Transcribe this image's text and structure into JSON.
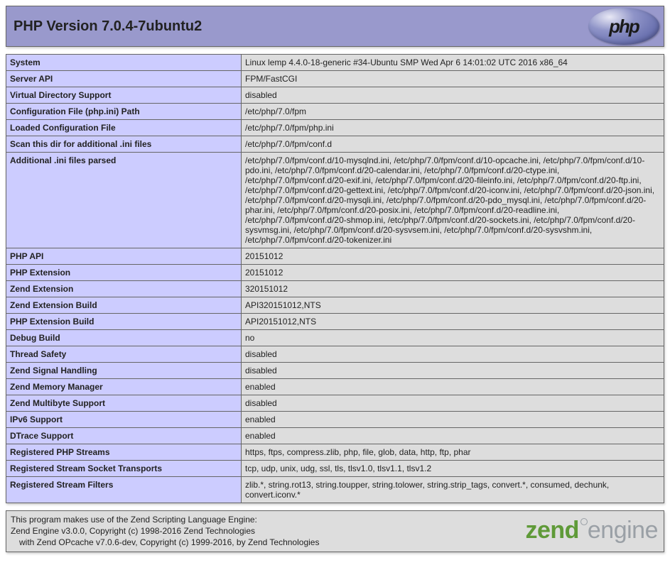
{
  "header": {
    "title": "PHP Version 7.0.4-7ubuntu2",
    "php_logo_text": "php"
  },
  "rows": [
    {
      "label": "System",
      "value": "Linux lemp 4.4.0-18-generic #34-Ubuntu SMP Wed Apr 6 14:01:02 UTC 2016 x86_64"
    },
    {
      "label": "Server API",
      "value": "FPM/FastCGI"
    },
    {
      "label": "Virtual Directory Support",
      "value": "disabled"
    },
    {
      "label": "Configuration File (php.ini) Path",
      "value": "/etc/php/7.0/fpm"
    },
    {
      "label": "Loaded Configuration File",
      "value": "/etc/php/7.0/fpm/php.ini"
    },
    {
      "label": "Scan this dir for additional .ini files",
      "value": "/etc/php/7.0/fpm/conf.d"
    },
    {
      "label": "Additional .ini files parsed",
      "value": "/etc/php/7.0/fpm/conf.d/10-mysqlnd.ini, /etc/php/7.0/fpm/conf.d/10-opcache.ini, /etc/php/7.0/fpm/conf.d/10-pdo.ini, /etc/php/7.0/fpm/conf.d/20-calendar.ini, /etc/php/7.0/fpm/conf.d/20-ctype.ini, /etc/php/7.0/fpm/conf.d/20-exif.ini, /etc/php/7.0/fpm/conf.d/20-fileinfo.ini, /etc/php/7.0/fpm/conf.d/20-ftp.ini, /etc/php/7.0/fpm/conf.d/20-gettext.ini, /etc/php/7.0/fpm/conf.d/20-iconv.ini, /etc/php/7.0/fpm/conf.d/20-json.ini, /etc/php/7.0/fpm/conf.d/20-mysqli.ini, /etc/php/7.0/fpm/conf.d/20-pdo_mysql.ini, /etc/php/7.0/fpm/conf.d/20-phar.ini, /etc/php/7.0/fpm/conf.d/20-posix.ini, /etc/php/7.0/fpm/conf.d/20-readline.ini, /etc/php/7.0/fpm/conf.d/20-shmop.ini, /etc/php/7.0/fpm/conf.d/20-sockets.ini, /etc/php/7.0/fpm/conf.d/20-sysvmsg.ini, /etc/php/7.0/fpm/conf.d/20-sysvsem.ini, /etc/php/7.0/fpm/conf.d/20-sysvshm.ini, /etc/php/7.0/fpm/conf.d/20-tokenizer.ini"
    },
    {
      "label": "PHP API",
      "value": "20151012"
    },
    {
      "label": "PHP Extension",
      "value": "20151012"
    },
    {
      "label": "Zend Extension",
      "value": "320151012"
    },
    {
      "label": "Zend Extension Build",
      "value": "API320151012,NTS"
    },
    {
      "label": "PHP Extension Build",
      "value": "API20151012,NTS"
    },
    {
      "label": "Debug Build",
      "value": "no"
    },
    {
      "label": "Thread Safety",
      "value": "disabled"
    },
    {
      "label": "Zend Signal Handling",
      "value": "disabled"
    },
    {
      "label": "Zend Memory Manager",
      "value": "enabled"
    },
    {
      "label": "Zend Multibyte Support",
      "value": "disabled"
    },
    {
      "label": "IPv6 Support",
      "value": "enabled"
    },
    {
      "label": "DTrace Support",
      "value": "enabled"
    },
    {
      "label": "Registered PHP Streams",
      "value": "https, ftps, compress.zlib, php, file, glob, data, http, ftp, phar"
    },
    {
      "label": "Registered Stream Socket Transports",
      "value": "tcp, udp, unix, udg, ssl, tls, tlsv1.0, tlsv1.1, tlsv1.2"
    },
    {
      "label": "Registered Stream Filters",
      "value": "zlib.*, string.rot13, string.toupper, string.tolower, string.strip_tags, convert.*, consumed, dechunk, convert.iconv.*"
    }
  ],
  "footer": {
    "line1": "This program makes use of the Zend Scripting Language Engine:",
    "line2": "Zend Engine v3.0.0, Copyright (c) 1998-2016 Zend Technologies",
    "line3": "with Zend OPcache v7.0.6-dev, Copyright (c) 1999-2016, by Zend Technologies",
    "zend_logo_bold": "zend",
    "zend_logo_light": "engine"
  }
}
